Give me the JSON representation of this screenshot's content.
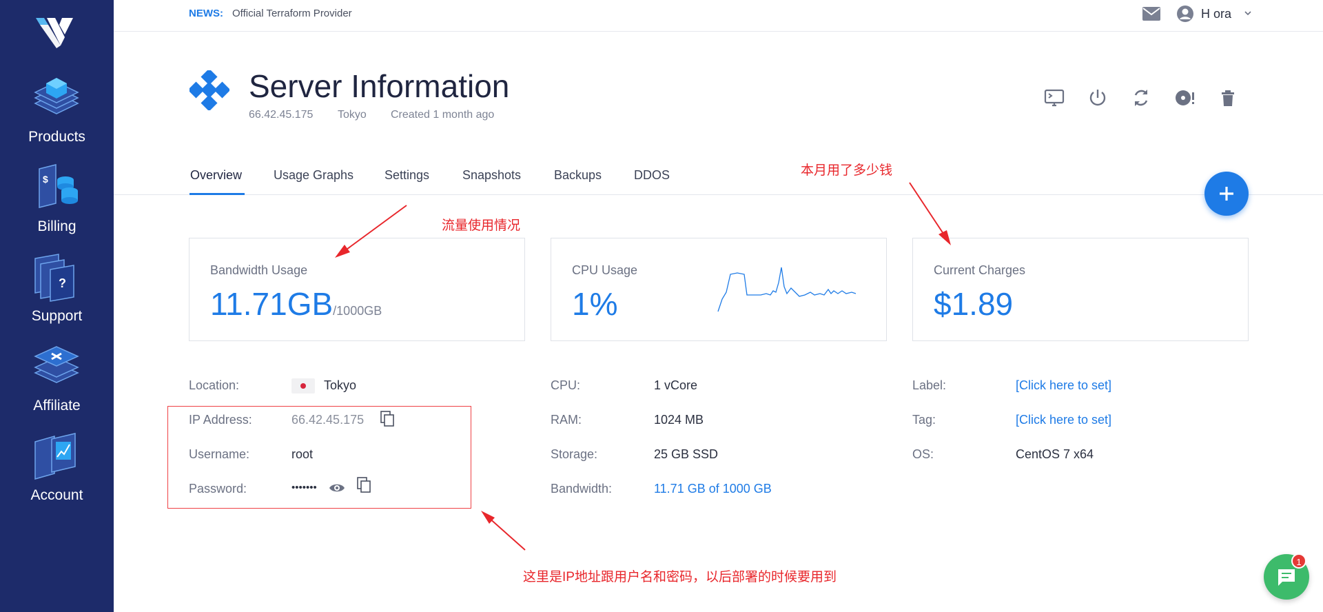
{
  "sidebar": {
    "items": [
      {
        "label": "Products"
      },
      {
        "label": "Billing"
      },
      {
        "label": "Support"
      },
      {
        "label": "Affiliate"
      },
      {
        "label": "Account"
      }
    ]
  },
  "topbar": {
    "news_label": "NEWS:",
    "news_text": "Official Terraform Provider",
    "user_name": "H ora"
  },
  "header": {
    "title": "Server Information",
    "ip": "66.42.45.175",
    "location": "Tokyo",
    "created": "Created 1 month ago",
    "actions": [
      "console-icon",
      "power-icon",
      "restart-icon",
      "iso-icon",
      "trash-icon"
    ]
  },
  "tabs": [
    {
      "label": "Overview",
      "active": true
    },
    {
      "label": "Usage Graphs"
    },
    {
      "label": "Settings"
    },
    {
      "label": "Snapshots"
    },
    {
      "label": "Backups"
    },
    {
      "label": "DDOS"
    }
  ],
  "cards": {
    "bandwidth": {
      "title": "Bandwidth Usage",
      "value": "11.71GB",
      "suffix": "/1000GB"
    },
    "cpu": {
      "title": "CPU Usage",
      "value": "1%"
    },
    "charges": {
      "title": "Current Charges",
      "value": "$1.89"
    }
  },
  "details": {
    "location": {
      "label": "Location:",
      "value": "Tokyo"
    },
    "ip": {
      "label": "IP Address:",
      "value": "66.42.45.175"
    },
    "username": {
      "label": "Username:",
      "value": "root"
    },
    "password": {
      "label": "Password:",
      "value": "•••••••"
    },
    "cpu": {
      "label": "CPU:",
      "value": "1 vCore"
    },
    "ram": {
      "label": "RAM:",
      "value": "1024 MB"
    },
    "storage": {
      "label": "Storage:",
      "value": "25 GB SSD"
    },
    "bandwidth": {
      "label": "Bandwidth:",
      "value": "11.71 GB of 1000 GB"
    },
    "label": {
      "label": "Label:",
      "value": "[Click here to set]"
    },
    "tag": {
      "label": "Tag:",
      "value": "[Click here to set]"
    },
    "os": {
      "label": "OS:",
      "value": "CentOS 7 x64"
    }
  },
  "annotations": {
    "bandwidth_note": "流量使用情况",
    "charges_note": "本月用了多少钱",
    "credentials_note": "这里是IP地址跟用户名和密码，以后部署的时候要用到"
  },
  "chat": {
    "badge": "1"
  },
  "colors": {
    "sidebar": "#1d2b6a",
    "accent": "#1e7be6",
    "annotation": "#e8262b",
    "chat": "#3dbb6b"
  }
}
